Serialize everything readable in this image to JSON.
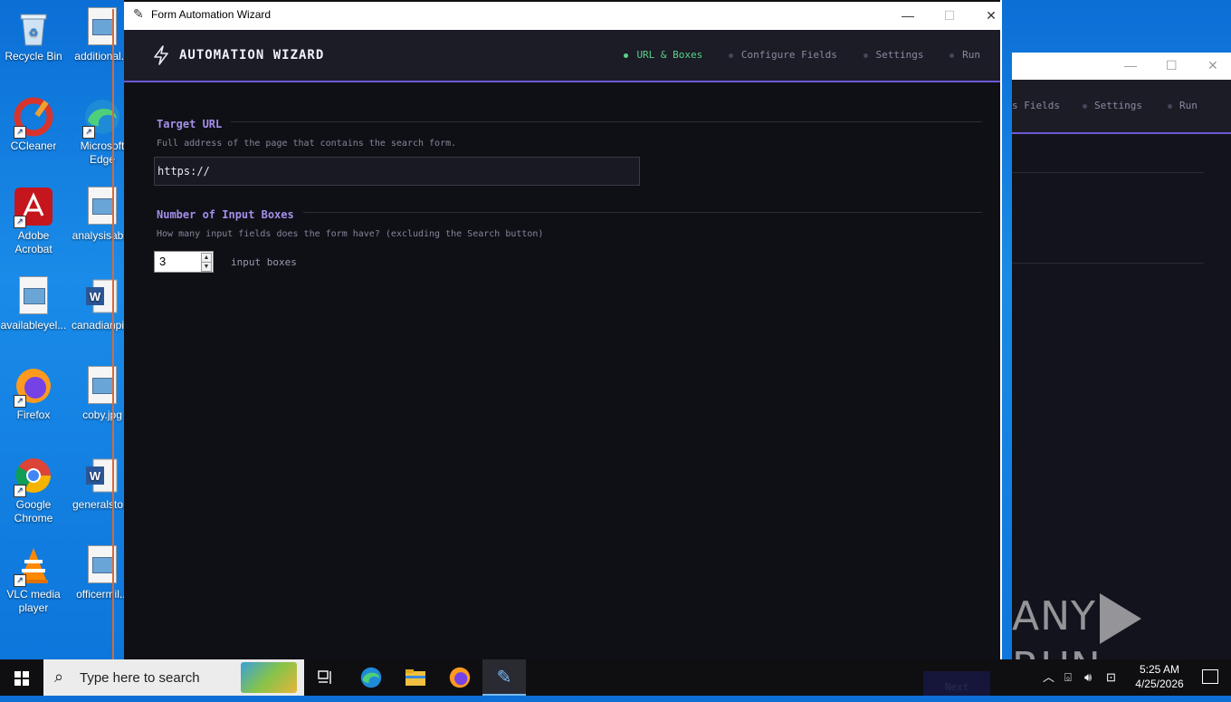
{
  "desktop": {
    "icons": [
      {
        "label": "Recycle Bin",
        "icon": "recycle-bin-icon"
      },
      {
        "label": "additional...",
        "icon": "image-file-icon"
      },
      {
        "label": "CCleaner",
        "icon": "ccleaner-icon"
      },
      {
        "label": "Microsoft Edge",
        "icon": "edge-icon"
      },
      {
        "label": "Adobe Acrobat",
        "icon": "acrobat-icon"
      },
      {
        "label": "analysisab...",
        "icon": "image-file-icon"
      },
      {
        "label": "availableyel...",
        "icon": "image-file-icon"
      },
      {
        "label": "canadianpi...",
        "icon": "word-doc-icon"
      },
      {
        "label": "Firefox",
        "icon": "firefox-icon"
      },
      {
        "label": "coby.jpg",
        "icon": "image-file-icon"
      },
      {
        "label": "Google Chrome",
        "icon": "chrome-icon"
      },
      {
        "label": "generalsto...",
        "icon": "word-doc-icon"
      },
      {
        "label": "VLC media player",
        "icon": "vlc-icon"
      },
      {
        "label": "officermil...",
        "icon": "image-file-icon"
      }
    ]
  },
  "background_window": {
    "steps": [
      "s Fields",
      "Settings",
      "Run"
    ]
  },
  "window": {
    "title": "Form Automation Wizard",
    "controls": {
      "minimize": "—",
      "maximize": "☐",
      "close": "✕"
    }
  },
  "wizard": {
    "title": "AUTOMATION WIZARD",
    "steps": [
      {
        "label": "URL & Boxes",
        "active": true
      },
      {
        "label": "Configure Fields",
        "active": false
      },
      {
        "label": "Settings",
        "active": false
      },
      {
        "label": "Run",
        "active": false
      }
    ],
    "accent_color": "#6b5ad6",
    "active_step_color": "#59d38a"
  },
  "target_url": {
    "label": "Target URL",
    "description": "Full address of the page that contains the search form.",
    "value": "https://"
  },
  "input_boxes": {
    "label": "Number of Input Boxes",
    "description": "How many input fields does the form have? (excluding the Search button)",
    "value": "3",
    "suffix": "input boxes"
  },
  "footer": {
    "next_label": "Next"
  },
  "taskbar": {
    "search_placeholder": "Type here to search",
    "time": "5:25 AM",
    "date": "4/25/2026"
  },
  "watermark": {
    "left": "ANY",
    "right": "RUN"
  }
}
